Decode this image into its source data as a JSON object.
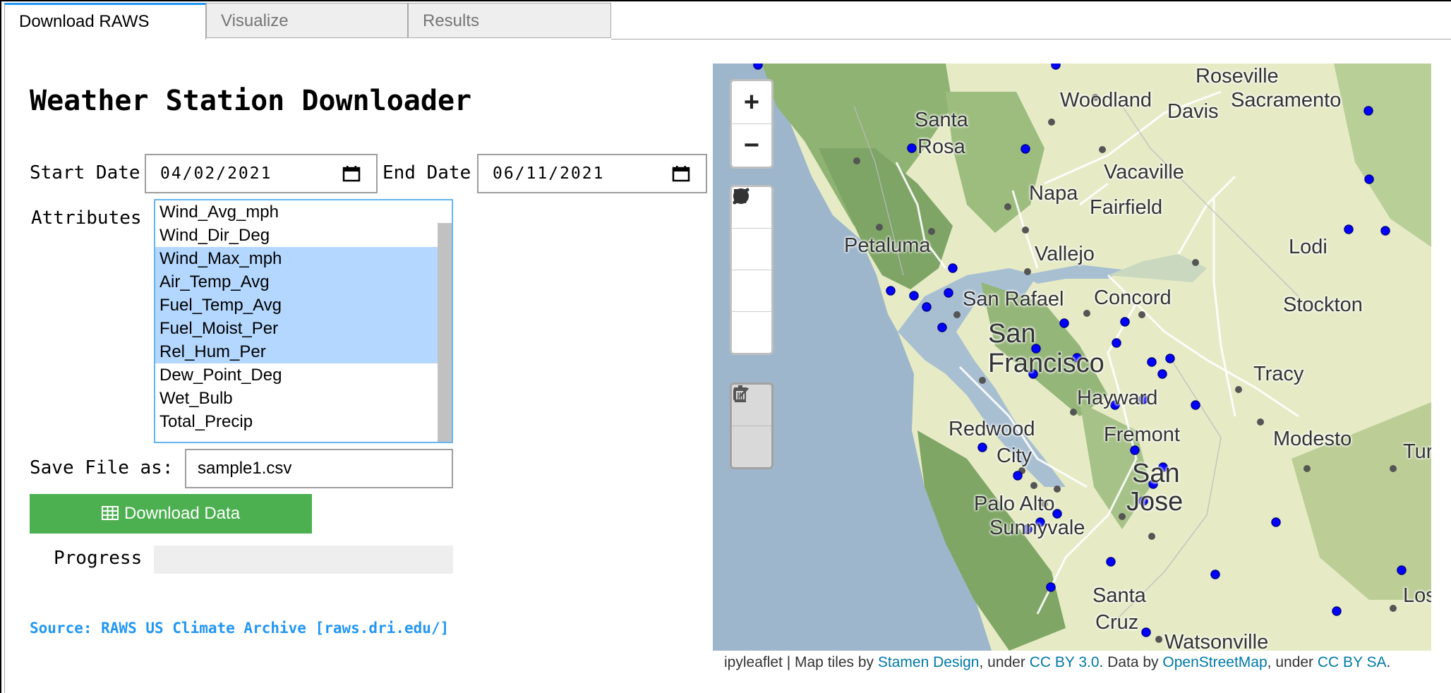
{
  "tabs": [
    {
      "label": "Download RAWS",
      "active": true
    },
    {
      "label": "Visualize",
      "active": false
    },
    {
      "label": "Results",
      "active": false
    }
  ],
  "panel": {
    "title": "Weather Station Downloader",
    "start_label": "Start Date",
    "start_value": "04/02/2021",
    "end_label": "End Date",
    "end_value": "06/11/2021",
    "attributes_label": "Attributes",
    "attributes": [
      {
        "label": "Wind_Avg_mph",
        "selected": false
      },
      {
        "label": "Wind_Dir_Deg",
        "selected": false
      },
      {
        "label": "Wind_Max_mph",
        "selected": true
      },
      {
        "label": "Air_Temp_Avg",
        "selected": true
      },
      {
        "label": "Fuel_Temp_Avg",
        "selected": true
      },
      {
        "label": "Fuel_Moist_Per",
        "selected": true
      },
      {
        "label": "Rel_Hum_Per",
        "selected": true
      },
      {
        "label": "Dew_Point_Deg",
        "selected": false
      },
      {
        "label": "Wet_Bulb",
        "selected": false
      },
      {
        "label": "Total_Precip",
        "selected": false
      }
    ],
    "save_label": "Save File as:",
    "save_value": "sample1.csv",
    "download_label": "Download Data",
    "download_icon": "table-icon",
    "progress_label": "Progress",
    "progress": 0,
    "source": "Source: RAWS US Climate Archive [raws.dri.edu/]"
  },
  "map": {
    "controls": {
      "zoom_in": "+",
      "zoom_out": "−",
      "draw_tools": [
        "polyline-icon",
        "polygon-icon",
        "rectangle-icon",
        "circle-icon"
      ],
      "edit_tools": [
        "edit-icon",
        "trash-icon"
      ]
    },
    "places": {
      "roseville": "Roseville",
      "woodland": "Woodland",
      "davis": "Davis",
      "sacramento": "Sacramento",
      "santa": "Santa",
      "rosa": "Rosa",
      "napa": "Napa",
      "vacaville": "Vacaville",
      "fairfield": "Fairfield",
      "petaluma": "Petaluma",
      "vallejo": "Vallejo",
      "lodi": "Lodi",
      "san_rafael": "San Rafael",
      "concord": "Concord",
      "stockton": "Stockton",
      "san": "San",
      "francisco": "Francisco",
      "hayward": "Hayward",
      "tracy": "Tracy",
      "redwood": "Redwood",
      "city": "City",
      "fremont": "Fremont",
      "modesto": "Modesto",
      "turl": "Turl",
      "san2": "San",
      "jose": "Jose",
      "palo_alto": "Palo Alto",
      "sunnyvale": "Sunnyvale",
      "santa2": "Santa",
      "cruz": "Cruz",
      "los": "Los",
      "watsonville": "Watsonville"
    },
    "attribution": {
      "prefix": "ipyleaflet | Map tiles by ",
      "stamen": "Stamen Design",
      "under1": ", under ",
      "ccby": "CC BY 3.0",
      "databy": ". Data by ",
      "osm": "OpenStreetMap",
      "under2": ", under ",
      "ccbysa": "CC BY SA",
      "end": "."
    },
    "colors": {
      "water": "#98b3c9",
      "land": "#e8ecc4",
      "hills": "#7fa865",
      "station": "#0000ff"
    }
  }
}
